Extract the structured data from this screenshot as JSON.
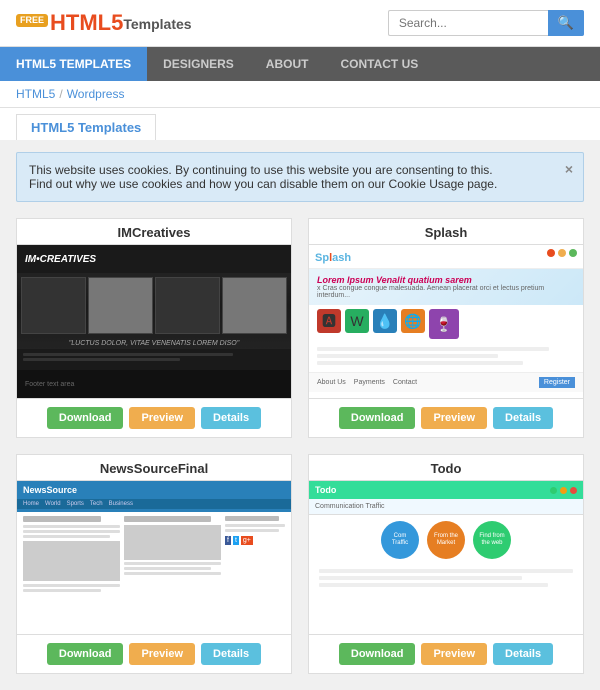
{
  "header": {
    "logo_free": "FREE",
    "logo_html5": "HTML5",
    "logo_templates": "Templates",
    "search_placeholder": "Search..."
  },
  "navbar": {
    "items": [
      {
        "label": "HTML5 TEMPLATES",
        "active": true
      },
      {
        "label": "DESIGNERS",
        "active": false
      },
      {
        "label": "ABOUT",
        "active": false
      },
      {
        "label": "CONTACT US",
        "active": false
      }
    ]
  },
  "breadcrumb": {
    "items": [
      "HTML5",
      "Wordpress"
    ]
  },
  "page_title": "HTML5 Templates",
  "cookie_banner": {
    "text1": "This website uses cookies. By continuing to use this website you are consenting to this.",
    "text2": "Find out why we use cookies and how you can disable them on our Cookie Usage page.",
    "close": "×"
  },
  "templates": [
    {
      "name": "IMCreatives",
      "buttons": {
        "download": "Download",
        "preview": "Preview",
        "details": "Details"
      }
    },
    {
      "name": "Splash",
      "buttons": {
        "download": "Download",
        "preview": "Preview",
        "details": "Details"
      }
    },
    {
      "name": "NewsSourceFinal",
      "buttons": {
        "download": "Download",
        "preview": "Preview",
        "details": "Details"
      }
    },
    {
      "name": "Todo",
      "buttons": {
        "download": "Download",
        "preview": "Preview",
        "details": "Details"
      }
    }
  ]
}
